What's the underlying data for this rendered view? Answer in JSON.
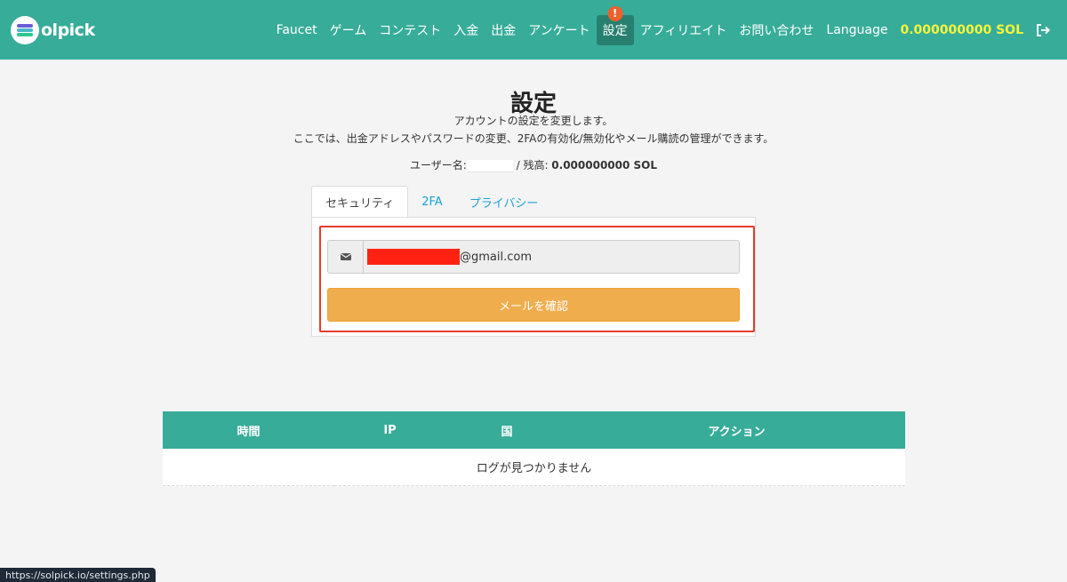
{
  "brand": {
    "logo_text": "olpick"
  },
  "nav": {
    "items": [
      {
        "label": "Faucet"
      },
      {
        "label": "ゲーム"
      },
      {
        "label": "コンテスト"
      },
      {
        "label": "入金"
      },
      {
        "label": "出金"
      },
      {
        "label": "アンケート"
      },
      {
        "label": "設定",
        "badge": "!"
      },
      {
        "label": "アフィリエイト"
      },
      {
        "label": "お問い合わせ"
      },
      {
        "label": "Language"
      }
    ],
    "balance": "0.000000000 SOL",
    "logout_icon": "logout-icon"
  },
  "page": {
    "title": "設定",
    "subtitle1": "アカウントの設定を変更します。",
    "subtitle2": "ここでは、出金アドレスやパスワードの変更、2FAの有効化/無効化やメール購読の管理ができます。",
    "username_label": "ユーザー名:",
    "balance_label": " / 残高: ",
    "balance_value": "0.000000000 SOL"
  },
  "tabs": [
    {
      "label": "セキュリティ",
      "active": true
    },
    {
      "label": "2FA",
      "active": false
    },
    {
      "label": "プライバシー",
      "active": false
    }
  ],
  "security": {
    "email_icon": "envelope-icon",
    "email_suffix": "@gmail.com",
    "confirm_button": "メールを確認"
  },
  "log_table": {
    "columns": [
      "時間",
      "IP",
      "国",
      "アクション"
    ],
    "empty_message": "ログが見つかりません"
  },
  "status_bar": {
    "url": "https://solpick.io/settings.php"
  },
  "colors": {
    "navbar": "#37ac99",
    "active_nav": "#27806f",
    "badge": "#f15f2b",
    "balance_text": "#f5f53b",
    "confirm_button": "#f0ad4e",
    "highlight": "#e53c2c",
    "tab_link": "#1ba2d8"
  }
}
